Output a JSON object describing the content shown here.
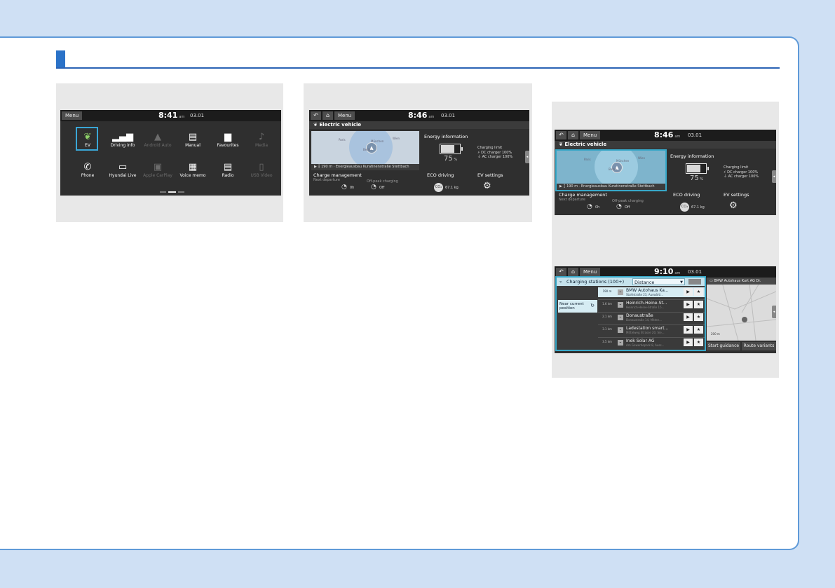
{
  "screen1": {
    "menu": "Menu",
    "time": "8:41",
    "ampm": "am",
    "date": "03.01",
    "tiles": [
      {
        "label": "EV",
        "icon": "leaf-icon",
        "glyph": "❦",
        "enabled": true,
        "selected": true
      },
      {
        "label": "Driving info",
        "icon": "bar-chart-icon",
        "glyph": "▂▄▆",
        "enabled": true
      },
      {
        "label": "Android Auto",
        "icon": "android-auto-icon",
        "glyph": "▲",
        "enabled": false
      },
      {
        "label": "Manual",
        "icon": "manual-icon",
        "glyph": "▤",
        "enabled": true
      },
      {
        "label": "Favourites",
        "icon": "favourites-folder-icon",
        "glyph": "▆",
        "enabled": true
      },
      {
        "label": "Media",
        "icon": "music-note-icon",
        "glyph": "♪",
        "enabled": false
      },
      {
        "label": "Phone",
        "icon": "phone-icon",
        "glyph": "✆",
        "enabled": true
      },
      {
        "label": "Hyundai Live",
        "icon": "live-icon",
        "glyph": "▭",
        "enabled": true
      },
      {
        "label": "Apple CarPlay",
        "icon": "carplay-icon",
        "glyph": "▣",
        "enabled": false
      },
      {
        "label": "Voice memo",
        "icon": "voice-memo-icon",
        "glyph": "▦",
        "enabled": true
      },
      {
        "label": "Radio",
        "icon": "radio-icon",
        "glyph": "▤",
        "enabled": true
      },
      {
        "label": "USB Video",
        "icon": "usb-video-icon",
        "glyph": "▯",
        "enabled": false
      }
    ]
  },
  "ev": {
    "menu": "Menu",
    "header": "Electric vehicle",
    "map_cities": [
      "Paris",
      "München",
      "Wien",
      "Berlin"
    ],
    "map_dist": "190 m",
    "map_station": "Energieausbau Kuratinenstraße Stettbach",
    "energy_title": "Energy information",
    "battery_pct": 75,
    "pct_value": "75",
    "pct_unit": "%",
    "charging_limit": "Charging limit",
    "dc": "DC charger 100%",
    "ac": "AC charger 100%",
    "charge_title": "Charge management",
    "charge_sub": "Next departure",
    "charge_val1": "0h",
    "charge_sub2": "Off-peak charging",
    "charge_val2": "Off",
    "eco_title": "ECO driving",
    "eco_val": "67.1 kg",
    "settings_title": "EV settings"
  },
  "screen2": {
    "time": "8:46",
    "ampm": "am",
    "date": "03.01"
  },
  "screen3": {
    "time": "8:46",
    "ampm": "am",
    "date": "03.01"
  },
  "screen4": {
    "menu": "Menu",
    "time": "9:10",
    "ampm": "am",
    "date": "03.01",
    "cs_title": "Charging stations (100+)",
    "sort": "Distance",
    "near": "Near current position",
    "dest_label": "BMW Autohaus Kurt AG Dr.",
    "start": "Start guidance",
    "variants": "Route variants",
    "scale": "200 m",
    "rows": [
      {
        "dist": "190 m",
        "name": "BMW Autohaus Ka...",
        "addr": "Stahlstraße 23, Auswärti..."
      },
      {
        "dist": "1.6 km",
        "name": "Heinrich-Heine-St...",
        "addr": "Heinrich-Heine-Straße 15..."
      },
      {
        "dist": "2.1 km",
        "name": "Donaustraße",
        "addr": "Donaustraße 14, Mitten..."
      },
      {
        "dist": "3.1 km",
        "name": "Ladestation smart...",
        "addr": "Mittelweg Strasse 20, Sie..."
      },
      {
        "dist": "3.5 km",
        "name": "Inek Solar AG",
        "addr": "Am Gewerbepark 8, Auss..."
      }
    ]
  }
}
